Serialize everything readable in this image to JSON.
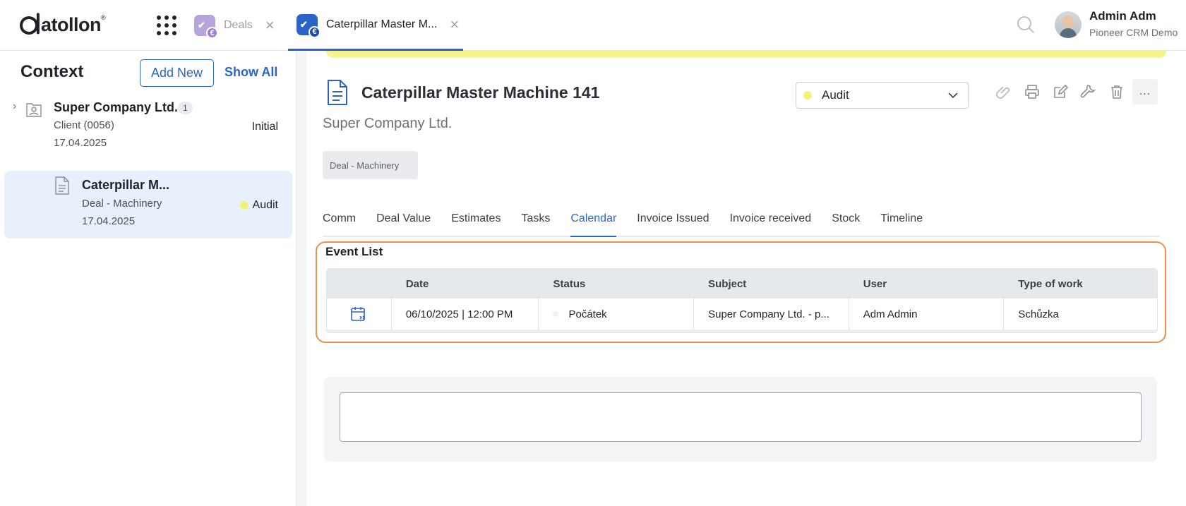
{
  "app": {
    "logo": "atollon",
    "logo_mark": "®"
  },
  "tabs": [
    {
      "label": "Deals"
    },
    {
      "label": "Caterpillar Master M..."
    }
  ],
  "user": {
    "name": "Admin Adm",
    "org": "Pioneer CRM Demo"
  },
  "sidebar": {
    "title": "Context",
    "add_new": "Add New",
    "show_all": "Show All",
    "items": [
      {
        "name": "Super Company Ltd.",
        "count": "1",
        "sub": "Client (0056)",
        "date": "17.04.2025",
        "status": "Initial"
      },
      {
        "name": "Caterpillar M...",
        "sub": "Deal - Machinery",
        "date": "17.04.2025",
        "status": "Audit"
      }
    ]
  },
  "deal": {
    "title": "Caterpillar Master Machine 141",
    "company": "Super Company Ltd.",
    "tag": "Deal - Machinery",
    "status": "Audit",
    "status_color": "#f4f17a",
    "more": "..."
  },
  "detail_tabs": [
    "Comm",
    "Deal Value",
    "Estimates",
    "Tasks",
    "Calendar",
    "Invoice Issued",
    "Invoice received",
    "Stock",
    "Timeline"
  ],
  "event_list": {
    "title": "Event List",
    "columns": [
      "Date",
      "Status",
      "Subject",
      "User",
      "Type of work"
    ],
    "rows": [
      {
        "date": "06/10/2025 | 12:00 PM",
        "status": "Počátek",
        "subject": "Super Company Ltd. - p...",
        "user": "Adm Admin",
        "type": "Schůzka"
      }
    ]
  },
  "colors": {
    "accent": "#2b64c8",
    "highlight_border": "#ef8f4d"
  }
}
